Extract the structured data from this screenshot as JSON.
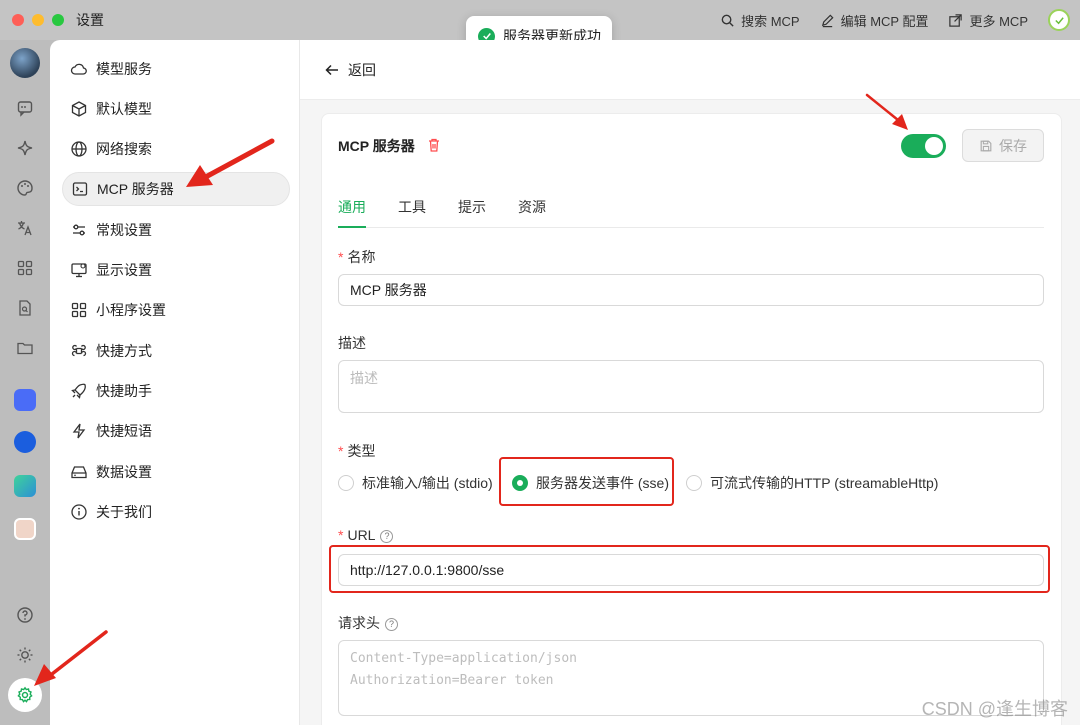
{
  "window": {
    "title": "设置"
  },
  "titlebar": {
    "actions": [
      {
        "label": "搜索 MCP",
        "icon": "search-icon"
      },
      {
        "label": "编辑 MCP 配置",
        "icon": "edit-icon"
      },
      {
        "label": "更多 MCP",
        "icon": "external-link-icon"
      }
    ]
  },
  "toast": {
    "message": "服务器更新成功",
    "icon": "check-circle-icon"
  },
  "rail": {
    "icons": [
      "avatar",
      "chat-icon",
      "sparkle-icon",
      "palette-icon",
      "translate-icon",
      "apps-grid-icon",
      "document-search-icon",
      "folder-icon",
      "app-blue-bird-icon",
      "app-blue-circle-icon",
      "app-green-icon",
      "app-avatar-icon",
      "help-icon",
      "sun-icon",
      "settings-icon"
    ]
  },
  "sidebar": {
    "items": [
      {
        "label": "模型服务",
        "icon": "cloud-icon"
      },
      {
        "label": "默认模型",
        "icon": "cube-icon"
      },
      {
        "label": "网络搜索",
        "icon": "globe-icon"
      },
      {
        "label": "MCP 服务器",
        "icon": "terminal-icon",
        "active": true
      },
      {
        "label": "常规设置",
        "icon": "sliders-icon"
      },
      {
        "label": "显示设置",
        "icon": "monitor-icon"
      },
      {
        "label": "小程序设置",
        "icon": "grid-icon"
      },
      {
        "label": "快捷方式",
        "icon": "command-icon"
      },
      {
        "label": "快捷助手",
        "icon": "rocket-icon"
      },
      {
        "label": "快捷短语",
        "icon": "zap-icon"
      },
      {
        "label": "数据设置",
        "icon": "hard-drive-icon"
      },
      {
        "label": "关于我们",
        "icon": "info-icon"
      }
    ]
  },
  "main": {
    "back_label": "返回",
    "card_title": "MCP 服务器",
    "enabled": true,
    "save_label": "保存",
    "tabs": [
      {
        "label": "通用",
        "active": true
      },
      {
        "label": "工具"
      },
      {
        "label": "提示"
      },
      {
        "label": "资源"
      }
    ],
    "form": {
      "name_label": "名称",
      "name_value": "MCP 服务器",
      "desc_label": "描述",
      "desc_placeholder": "描述",
      "type_label": "类型",
      "type_options": [
        {
          "label": "标准输入/输出 (stdio)",
          "selected": false
        },
        {
          "label": "服务器发送事件 (sse)",
          "selected": true
        },
        {
          "label": "可流式传输的HTTP (streamableHttp)",
          "selected": false
        }
      ],
      "url_label": "URL",
      "url_value": "http://127.0.0.1:9800/sse",
      "headers_label": "请求头",
      "headers_placeholder_line1": "Content-Type=application/json",
      "headers_placeholder_line2": "Authorization=Bearer token"
    }
  },
  "watermark": "CSDN @逢生博客",
  "colors": {
    "accent": "#1aad5a",
    "highlight": "#e2261c"
  }
}
